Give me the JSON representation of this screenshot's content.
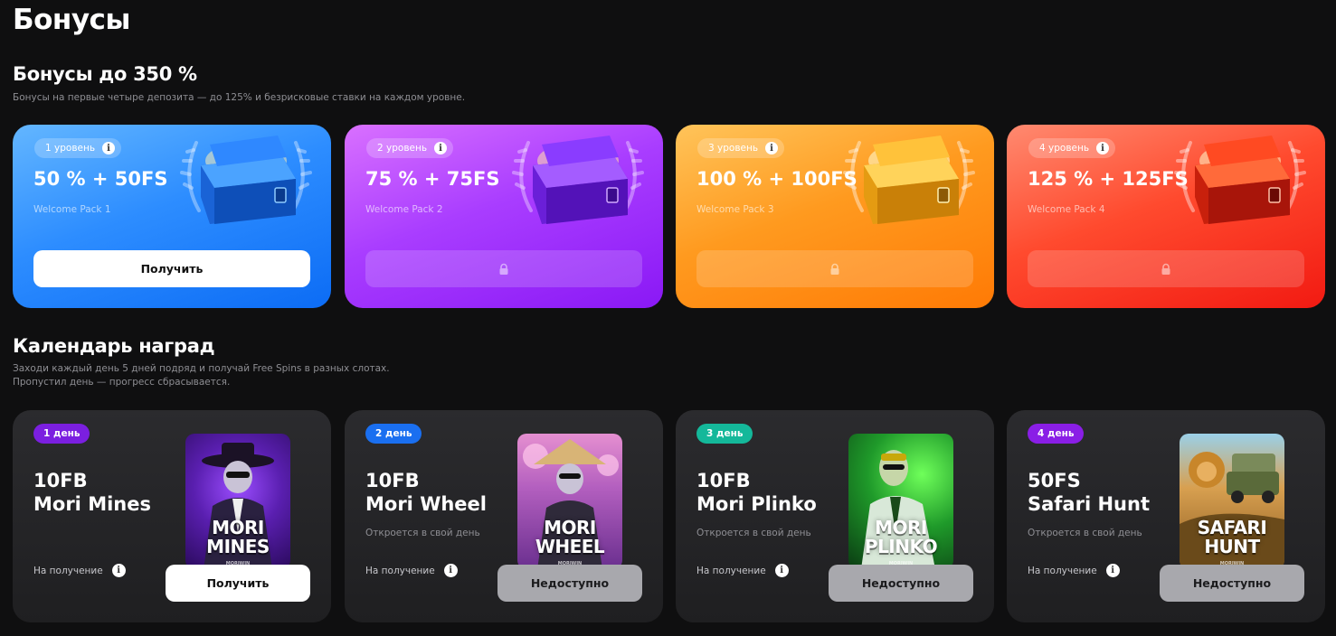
{
  "page": {
    "title": "Бонусы"
  },
  "bonuses": {
    "title": "Бонусы до 350 %",
    "subtitle": "Бонусы на первые четыре депозита — до 125% и безрисковые ставки на каждом уровне.",
    "cards": [
      {
        "level": "1 уровень",
        "amount": "50 % + 50FS",
        "pack": "Welcome Pack 1",
        "button": "Получить",
        "locked": false,
        "color": "#2d8dff"
      },
      {
        "level": "2 уровень",
        "amount": "75 % + 75FS",
        "pack": "Welcome Pack 2",
        "button": "",
        "locked": true,
        "color": "#a93dff"
      },
      {
        "level": "3 уровень",
        "amount": "100 % + 100FS",
        "pack": "Welcome Pack 3",
        "button": "",
        "locked": true,
        "color": "#ff9a1f"
      },
      {
        "level": "4 уровень",
        "amount": "125 % + 125FS",
        "pack": "Welcome Pack 4",
        "button": "",
        "locked": true,
        "color": "#ff4a2e"
      }
    ]
  },
  "calendar": {
    "title": "Календарь наград",
    "subtitle_line1": "Заходи каждый день 5 дней подряд и получай Free Spins в разных слотах.",
    "subtitle_line2": "Пропустил день — прогресс сбрасывается.",
    "receive_label": "На получение",
    "days": [
      {
        "day": "1 день",
        "badge_color": "#7b1fe0",
        "prize_line1": "10FB",
        "prize_line2": "Mori Mines",
        "note": "",
        "game_title_1": "MORI",
        "game_title_2": "MINES",
        "brand": "MORIWIN",
        "button": "Получить",
        "active": true
      },
      {
        "day": "2 день",
        "badge_color": "#1a6ff0",
        "prize_line1": "10FB",
        "prize_line2": "Mori Wheel",
        "note": "Откроется в свой день",
        "game_title_1": "MORI",
        "game_title_2": "WHEEL",
        "brand": "MORIWIN",
        "button": "Недоступно",
        "active": false
      },
      {
        "day": "3 день",
        "badge_color": "#14b89a",
        "prize_line1": "10FB",
        "prize_line2": "Mori Plinko",
        "note": "Откроется в свой день",
        "game_title_1": "MORI",
        "game_title_2": "PLINKO",
        "brand": "MORIWIN",
        "button": "Недоступно",
        "active": false
      },
      {
        "day": "4 день",
        "badge_color": "#8a1ee6",
        "prize_line1": "50FS",
        "prize_line2": "Safari Hunt",
        "note": "Откроется в свой день",
        "game_title_1": "SAFARI",
        "game_title_2": "HUNT",
        "brand": "MORIWIN",
        "button": "Недоступно",
        "active": false
      }
    ]
  }
}
